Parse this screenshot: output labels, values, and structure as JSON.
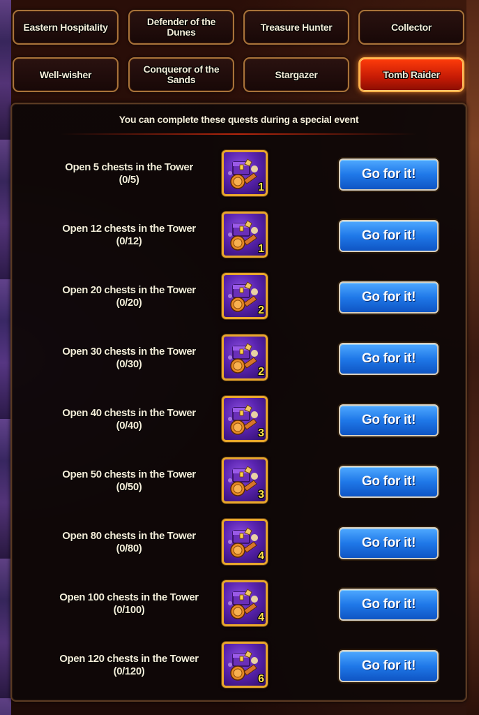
{
  "tabs": [
    {
      "label": "Eastern Hospitality",
      "active": false
    },
    {
      "label": "Defender of the Dunes",
      "active": false
    },
    {
      "label": "Treasure Hunter",
      "active": false
    },
    {
      "label": "Collector",
      "active": false
    },
    {
      "label": "Well-wisher",
      "active": false
    },
    {
      "label": "Conqueror of the Sands",
      "active": false
    },
    {
      "label": "Stargazer",
      "active": false
    },
    {
      "label": "Tomb Raider",
      "active": true
    }
  ],
  "notice": "You can complete these quests during a special event",
  "reward_icon": "chest-bundle-icon",
  "colors": {
    "active_tab": "#e0280a",
    "button_blue": "#1f78e8",
    "reward_border": "#e8a72c",
    "reward_count": "#ffe24a"
  },
  "quests": [
    {
      "title": "Open 5 chests in the Tower",
      "progress": "(0/5)",
      "reward_count": "1",
      "button": "Go for it!"
    },
    {
      "title": "Open 12 chests in the Tower",
      "progress": "(0/12)",
      "reward_count": "1",
      "button": "Go for it!"
    },
    {
      "title": "Open 20 chests in the Tower",
      "progress": "(0/20)",
      "reward_count": "2",
      "button": "Go for it!"
    },
    {
      "title": "Open 30 chests in the Tower",
      "progress": "(0/30)",
      "reward_count": "2",
      "button": "Go for it!"
    },
    {
      "title": "Open 40 chests in the Tower",
      "progress": "(0/40)",
      "reward_count": "3",
      "button": "Go for it!"
    },
    {
      "title": "Open 50 chests in the Tower",
      "progress": "(0/50)",
      "reward_count": "3",
      "button": "Go for it!"
    },
    {
      "title": "Open 80 chests in the Tower",
      "progress": "(0/80)",
      "reward_count": "4",
      "button": "Go for it!"
    },
    {
      "title": "Open 100 chests in the Tower",
      "progress": "(0/100)",
      "reward_count": "4",
      "button": "Go for it!"
    },
    {
      "title": "Open 120 chests in the Tower",
      "progress": "(0/120)",
      "reward_count": "6",
      "button": "Go for it!"
    }
  ]
}
